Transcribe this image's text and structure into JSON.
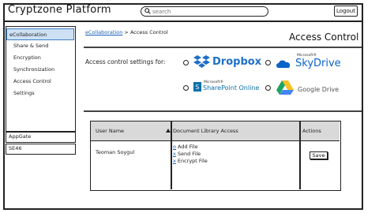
{
  "header": {
    "app_title": "Cryptzone Platform",
    "search_placeholder": "search",
    "logout_label": "Logout"
  },
  "sidebar": {
    "items": [
      {
        "label": "eCollaboration",
        "active": true
      },
      {
        "label": "Share & Send"
      },
      {
        "label": "Encryption"
      },
      {
        "label": "Synchronization"
      },
      {
        "label": "Access Control"
      },
      {
        "label": "Settings"
      }
    ],
    "bottom_items": [
      {
        "label": "AppGate"
      },
      {
        "label": "SE46"
      }
    ]
  },
  "breadcrumb": {
    "link": "eCollaboration",
    "separator": ">",
    "current": "Access Control"
  },
  "page_title": "Access Control",
  "settings": {
    "label": "Access control settings for:",
    "providers": [
      {
        "name": "Dropbox",
        "icon": "dropbox-logo",
        "color": "#1f6fc7"
      },
      {
        "name": "SkyDrive",
        "prefix": "Microsoft®",
        "icon": "skydrive-logo",
        "color": "#0a64c8"
      },
      {
        "name": "SharePoint Online",
        "prefix": "Microsoft®",
        "icon": "sharepoint-logo",
        "color": "#0b6fa8"
      },
      {
        "name": "Google Drive",
        "icon": "google-drive-logo",
        "color": "#555555"
      }
    ]
  },
  "table": {
    "headers": [
      "User Name",
      "Document Library Access",
      "Actions"
    ],
    "rows": [
      {
        "user": "Teoman Soygul",
        "permissions": [
          {
            "mark": "o",
            "label": "Add File"
          },
          {
            "mark": "x",
            "label": "Send File"
          },
          {
            "mark": "x",
            "label": "Encrypt File"
          }
        ],
        "action_label": "Save"
      }
    ]
  }
}
